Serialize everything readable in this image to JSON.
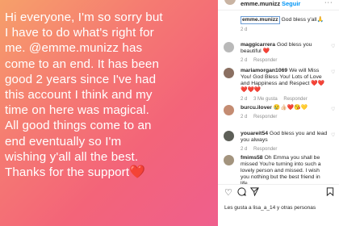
{
  "post": {
    "caption_lines": [
      "Hi everyone, I'm so sorry but",
      "I have to do what's right for",
      "me. @emme.munizz has",
      "come to an end. It has been",
      "good 2 years since I've had",
      "this account I think and my",
      "time on here was magical.",
      "All good things come to an",
      "end eventually so I'm",
      "wishing y'all all the best.",
      "Thanks for the support"
    ],
    "heart_glyph": "❤️"
  },
  "header": {
    "username": "emme.munizz",
    "separator": "•",
    "follow_label": "Seguir",
    "more_glyph": "···"
  },
  "caption_comment": {
    "username": "emme.munizz",
    "text": "God bless y'all🙏",
    "time": "2 d"
  },
  "comments": [
    {
      "username": "maggicarrera",
      "text": "God bless you beautiful ❤️",
      "time": "2 d",
      "likes": "",
      "reply": "Responder",
      "avatar_color": "#b9b9b9"
    },
    {
      "username": "mariamorgan1069",
      "text": "We will Miss You! God Bless You! Lots of Love and Happiness and Respect ❤️❤️❤️❤️❤️",
      "time": "2 d",
      "likes": "3 Me gusta",
      "reply": "Responder",
      "avatar_color": "#8a6f61"
    },
    {
      "username": "burcu.ilover",
      "text": "😢👍🏻❤️😘💛",
      "time": "2 d",
      "likes": "",
      "reply": "Responder",
      "avatar_color": "#c48c72"
    },
    {
      "username": "youareit54",
      "text": "God bless you and lead you always",
      "time": "2 d",
      "likes": "",
      "reply": "Responder",
      "avatar_color": "#5d5f58"
    },
    {
      "username": "fmims58",
      "text": "Oh Emma you shall be missed You're turning into such a lovely person and missed. I wish you nothing but the best friend in life.",
      "time": "",
      "likes": "",
      "reply": "",
      "avatar_color": "#a3947e"
    }
  ],
  "actions": {
    "like_icon": "heart-outline",
    "comment_icon": "speech-bubble",
    "share_icon": "paper-plane",
    "save_icon": "bookmark"
  },
  "likes_text": "Les gusta a lisa_a_14 y otras personas"
}
